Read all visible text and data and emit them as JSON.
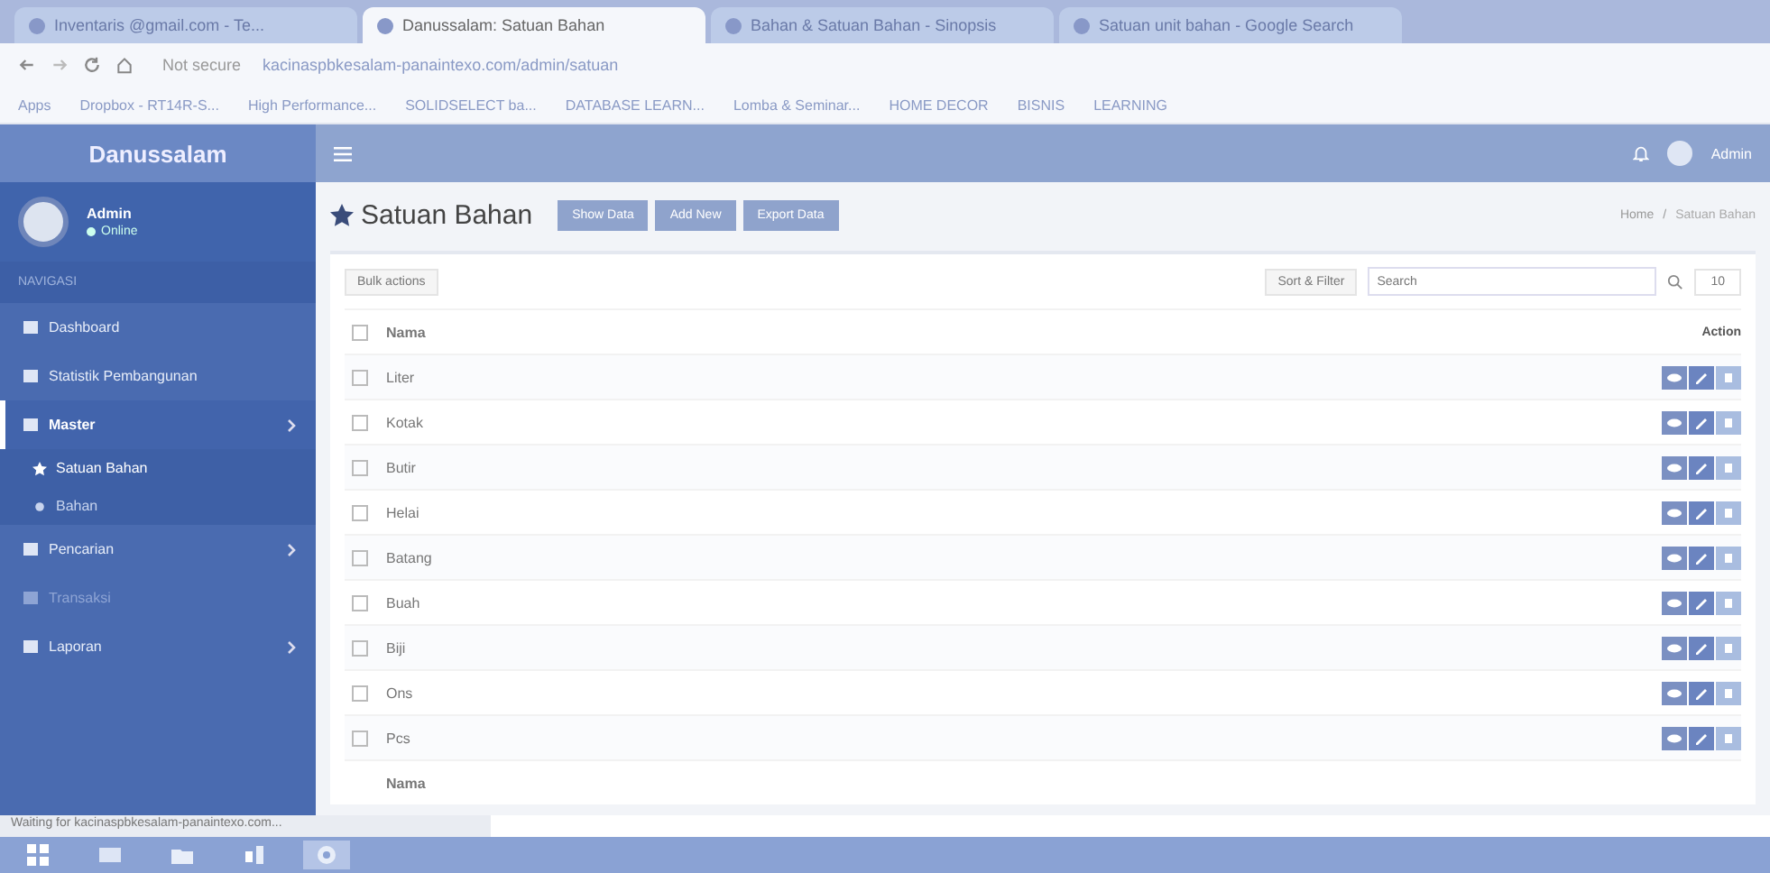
{
  "browser": {
    "tabs": [
      {
        "label": "Inventaris @gmail.com - Te...",
        "selected": false
      },
      {
        "label": "Danussalam: Satuan Bahan",
        "selected": true
      },
      {
        "label": "Bahan & Satuan Bahan - Sinopsis",
        "selected": false
      },
      {
        "label": "Satuan unit bahan - Google Search",
        "selected": false
      }
    ],
    "address": {
      "security": "Not secure",
      "url": "kacinaspbkesalam-panaintexo.com/admin/satuan"
    },
    "bookmarks": [
      "Apps",
      "Dropbox - RT14R-S...",
      "High Performance...",
      "SOLIDSELECT ba...",
      "DATABASE LEARN...",
      "Lomba & Seminar...",
      "HOME DECOR",
      "BISNIS",
      "LEARNING"
    ]
  },
  "app": {
    "brand": "Danussalam",
    "user": {
      "name": "Admin",
      "status": "Online"
    },
    "top_user": "Admin",
    "sidebar": {
      "heading": "NAVIGASI",
      "items": [
        {
          "label": "Dashboard",
          "kind": "link",
          "selected": false
        },
        {
          "label": "Statistik Pembangunan",
          "kind": "link",
          "selected": false
        },
        {
          "label": "Master",
          "kind": "menu",
          "selected": true,
          "children": [
            {
              "label": "Satuan Bahan",
              "selected": true
            },
            {
              "label": "Bahan",
              "selected": false
            }
          ]
        },
        {
          "label": "Pencarian",
          "kind": "menu",
          "selected": false
        },
        {
          "label": "Transaksi",
          "kind": "disabled",
          "selected": false
        },
        {
          "label": "Laporan",
          "kind": "menu",
          "selected": false
        }
      ]
    },
    "page": {
      "title": "Satuan Bahan",
      "actions": [
        "Show Data",
        "Add New",
        "Export Data"
      ],
      "breadcrumb": [
        "Home",
        "/",
        "Satuan Bahan"
      ]
    },
    "toolbar": {
      "bulk": "Bulk actions",
      "filter": "Sort & Filter",
      "search": {
        "placeholder": "Search"
      },
      "per_page": "10"
    },
    "table": {
      "columns": [
        "Nama",
        "Action"
      ],
      "all_checked": false,
      "rows": [
        {
          "name": "Liter",
          "checked": false
        },
        {
          "name": "Kotak",
          "checked": false
        },
        {
          "name": "Butir",
          "checked": false
        },
        {
          "name": "Helai",
          "checked": false
        },
        {
          "name": "Batang",
          "checked": false
        },
        {
          "name": "Buah",
          "checked": false
        },
        {
          "name": "Biji",
          "checked": false
        },
        {
          "name": "Ons",
          "checked": false
        },
        {
          "name": "Pcs",
          "checked": false
        }
      ],
      "footer": "Nama"
    }
  },
  "status_bar": "Waiting for kacinaspbkesalam-panaintexo.com..."
}
